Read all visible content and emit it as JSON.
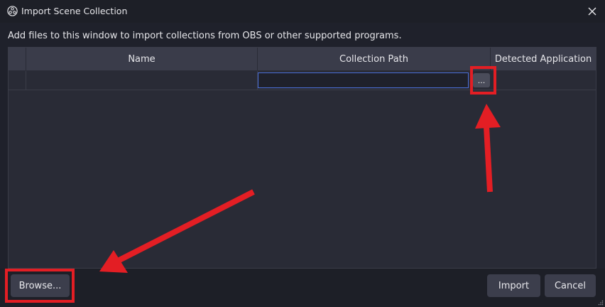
{
  "window": {
    "title": "Import Scene Collection",
    "app_icon": "obs-logo-icon",
    "close_icon": "close-icon"
  },
  "description": "Add files to this window to import collections from OBS or other supported programs.",
  "table": {
    "columns": [
      "",
      "Name",
      "Collection Path",
      "Detected Application"
    ],
    "rows": [
      {
        "name": "",
        "path": "",
        "browse_button": "...",
        "application": ""
      }
    ]
  },
  "footer": {
    "browse_label": "Browse...",
    "import_label": "Import",
    "cancel_label": "Cancel"
  },
  "annotations": {
    "highlight_color": "#e31e24",
    "highlights": [
      "row-browse-button",
      "browse-button"
    ]
  },
  "colors": {
    "background": "#1f212b",
    "header": "#3a3c4a",
    "button": "#3c3e4c",
    "focus": "#4b6fd8"
  }
}
